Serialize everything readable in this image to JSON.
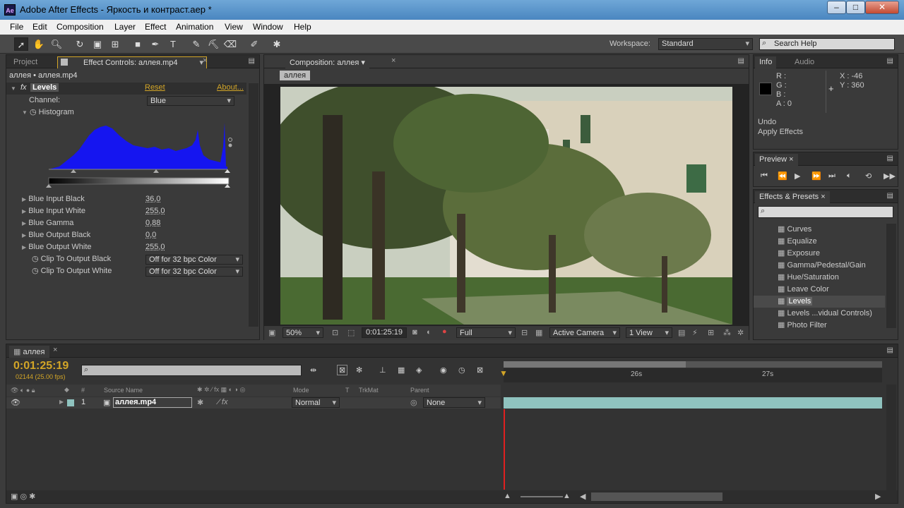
{
  "window": {
    "title": "Adobe After Effects - Яркость и контраст.aep *",
    "icon": "Ae"
  },
  "menu": [
    "File",
    "Edit",
    "Composition",
    "Layer",
    "Effect",
    "Animation",
    "View",
    "Window",
    "Help"
  ],
  "toolbar": {
    "workspace_label": "Workspace:",
    "workspace_value": "Standard",
    "search_placeholder": "Search Help"
  },
  "left_panel": {
    "tabs": [
      "Project",
      "Effect Controls: аллея.mp4"
    ],
    "breadcrumb": "аллея • аллея.mp4",
    "effect_name": "Levels",
    "reset": "Reset",
    "about": "About...",
    "channel_label": "Channel:",
    "channel_value": "Blue",
    "histogram_label": "Histogram",
    "props": [
      {
        "label": "Blue Input Black",
        "value": "36,0"
      },
      {
        "label": "Blue Input White",
        "value": "255,0"
      },
      {
        "label": "Blue Gamma",
        "value": "0,88"
      },
      {
        "label": "Blue Output Black",
        "value": "0,0"
      },
      {
        "label": "Blue Output White",
        "value": "255,0"
      }
    ],
    "clips": [
      {
        "label": "Clip To Output Black",
        "value": "Off for 32 bpc Color"
      },
      {
        "label": "Clip To Output White",
        "value": "Off for 32 bpc Color"
      }
    ]
  },
  "comp_panel": {
    "tab": "Composition: аллея",
    "subtab": "аллея",
    "zoom": "50%",
    "timecode": "0:01:25:19",
    "resolution": "Full",
    "camera": "Active Camera",
    "view": "1 View"
  },
  "info_panel": {
    "tabs": [
      "Info",
      "Audio"
    ],
    "r": "R :",
    "g": "G :",
    "b": "B :",
    "a": "A : 0",
    "x": "X : -46",
    "y": "Y : 360",
    "undo": "Undo",
    "last_action": "Apply Effects"
  },
  "preview_panel": {
    "tab": "Preview"
  },
  "effects_panel": {
    "tab": "Effects & Presets",
    "items": [
      "Curves",
      "Equalize",
      "Exposure",
      "Gamma/Pedestal/Gain",
      "Hue/Saturation",
      "Leave Color",
      "Levels",
      "Levels ...vidual Controls)",
      "Photo Filter"
    ],
    "selected": "Levels"
  },
  "timeline": {
    "tab": "аллея",
    "timecode": "0:01:25:19",
    "frames": "02144 (25.00 fps)",
    "ruler": [
      "26s",
      "27s"
    ],
    "columns": {
      "source": "Source Name",
      "mode": "Mode",
      "t": "T",
      "trkmat": "TrkMat",
      "parent": "Parent",
      "num": "#"
    },
    "layer": {
      "num": "1",
      "name": "аллея.mp4",
      "mode": "Normal",
      "parent": "None"
    }
  },
  "colors": {
    "accent": "#d2a527",
    "track": "#8fc3bf",
    "playhead": "#e02020"
  }
}
